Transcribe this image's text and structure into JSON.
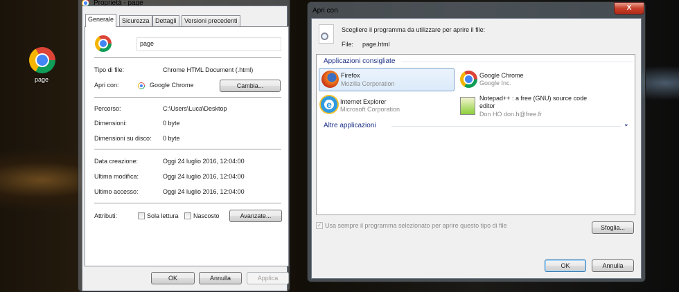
{
  "desktop": {
    "icon_label": "page"
  },
  "properties": {
    "title": "Proprietà - page",
    "tabs": [
      "Generale",
      "Sicurezza",
      "Dettagli",
      "Versioni precedenti"
    ],
    "filename": "page",
    "rows": {
      "file_type_label": "Tipo di file:",
      "file_type": "Chrome HTML Document (.html)",
      "open_with_label": "Apri con:",
      "open_with": "Google Chrome",
      "change": "Cambia...",
      "path_label": "Percorso:",
      "path": "C:\\Users\\Luca\\Desktop",
      "size_label": "Dimensioni:",
      "size": "0 byte",
      "disk_size_label": "Dimensioni su disco:",
      "disk_size": "0 byte",
      "created_label": "Data creazione:",
      "created": "Oggi 24 luglio 2016, 12:04:00",
      "modified_label": "Ultima modifica:",
      "modified": "Oggi 24 luglio 2016, 12:04:00",
      "accessed_label": "Ultimo accesso:",
      "accessed": "Oggi 24 luglio 2016, 12:04:00",
      "attributes_label": "Attributi:",
      "readonly": "Sola lettura",
      "hidden": "Nascosto",
      "advanced": "Avanzate..."
    },
    "buttons": {
      "ok": "OK",
      "cancel": "Annulla",
      "apply": "Applica"
    }
  },
  "open_with": {
    "title": "Apri con",
    "close": "X",
    "prompt": "Scegliere il programma da utilizzare per aprire il file:",
    "file_label": "File:",
    "file": "page.html",
    "recommended": "Applicazioni consigliate",
    "apps": [
      {
        "name": "Firefox",
        "vendor": "Mozilla Corporation"
      },
      {
        "name": "Google Chrome",
        "vendor": "Google Inc."
      },
      {
        "name": "Internet Explorer",
        "vendor": "Microsoft Corporation"
      },
      {
        "name": "Notepad++ : a free (GNU) source code editor",
        "vendor": "Don HO don.h@free.fr"
      }
    ],
    "other": "Altre applicazioni",
    "always_use": "Usa sempre il programma selezionato per aprire questo tipo di file",
    "browse": "Sfoglia...",
    "ok": "OK",
    "cancel": "Annulla"
  }
}
